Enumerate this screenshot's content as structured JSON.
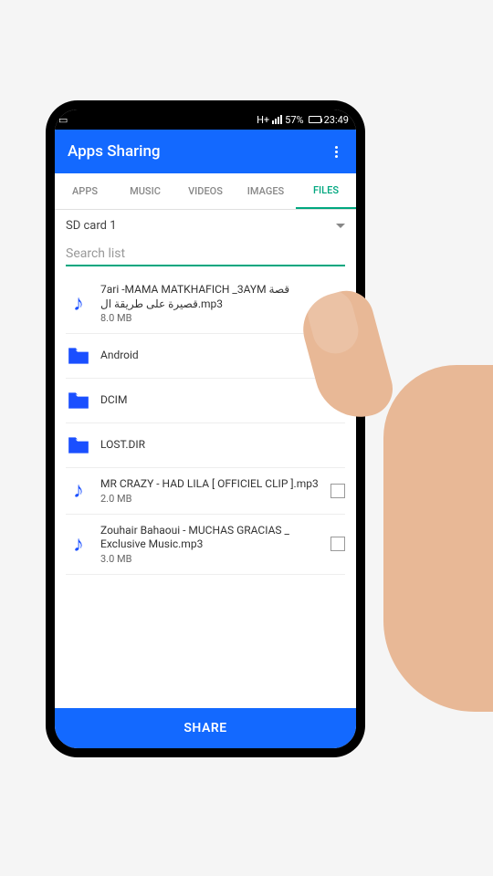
{
  "status_bar": {
    "signal_type": "H+",
    "battery_percent": "57%",
    "time": "23:49"
  },
  "header": {
    "title": "Apps Sharing"
  },
  "tabs": [
    {
      "label": "APPS",
      "active": false
    },
    {
      "label": "MUSIC",
      "active": false
    },
    {
      "label": "VIDEOS",
      "active": false
    },
    {
      "label": "IMAGES",
      "active": false
    },
    {
      "label": "FILES",
      "active": true
    }
  ],
  "storage": {
    "selected": "SD card 1"
  },
  "search": {
    "placeholder": "Search list"
  },
  "files": [
    {
      "type": "music",
      "name": "7ari -MAMA MATKHAFICH _3AYM قصة قصيرة على طريقة ال.mp3",
      "size": "8.0 MB",
      "has_checkbox": true
    },
    {
      "type": "folder",
      "name": "Android",
      "size": null,
      "has_checkbox": false
    },
    {
      "type": "folder",
      "name": "DCIM",
      "size": null,
      "has_checkbox": false
    },
    {
      "type": "folder",
      "name": "LOST.DIR",
      "size": null,
      "has_checkbox": false
    },
    {
      "type": "music",
      "name": "MR CRAZY - HAD LILA  [ OFFICIEL CLIP ].mp3",
      "size": "2.0 MB",
      "has_checkbox": true
    },
    {
      "type": "music",
      "name": "Zouhair Bahaoui - MUCHAS GRACIAS _ Exclusive Music.mp3",
      "size": "3.0 MB",
      "has_checkbox": true
    }
  ],
  "footer": {
    "share_label": "SHARE"
  }
}
